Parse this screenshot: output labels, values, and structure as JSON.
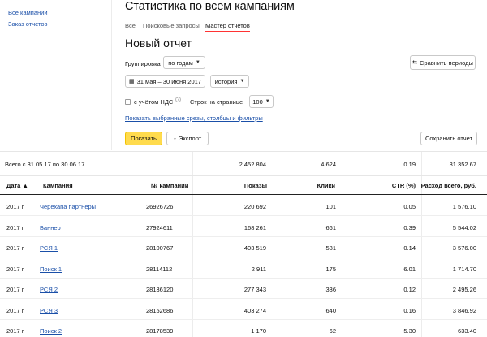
{
  "nav": {
    "all_campaigns": "Все кампании",
    "order_reports": "Заказ отчетов"
  },
  "header": {
    "title": "Статистика по всем кампаниям",
    "tabs": [
      {
        "label": "Все",
        "active": false
      },
      {
        "label": "Поисковые запросы",
        "active": false
      },
      {
        "label": "Мастер отчетов",
        "active": true
      }
    ]
  },
  "report": {
    "title": "Новый отчет",
    "grouping_label": "Группировка",
    "grouping_value": "по годам",
    "compare_periods": "Сравнить периоды",
    "date_range": "31 мая – 30 июня 2017",
    "history_value": "история",
    "vat_label": "с учётом НДС",
    "vat_help": "?",
    "rows_per_page_label": "Строк на странице",
    "rows_per_page_value": "100",
    "show_selected_link": "Показать выбранные срезы, столбцы и фильтры",
    "show_button": "Показать",
    "export_button": "Экспорт",
    "save_button": "Сохранить отчет"
  },
  "totals": {
    "label": "Всего с 31.05.17 по 30.06.17",
    "impressions": "2 452 804",
    "clicks": "4 624",
    "ctr": "0.19",
    "spend": "31 352.67"
  },
  "table": {
    "columns": [
      "Дата ▲",
      "Кампания",
      "№ кампании",
      "Показы",
      "Клики",
      "CTR (%)",
      "Расход всего, руб."
    ],
    "rows": [
      {
        "date": "2017 г",
        "campaign": "Черехапа партнёры",
        "id": "26926726",
        "impressions": "220 692",
        "clicks": "101",
        "ctr": "0.05",
        "spend": "1 576.10"
      },
      {
        "date": "2017 г",
        "campaign": "Баннер",
        "id": "27924611",
        "impressions": "168 261",
        "clicks": "661",
        "ctr": "0.39",
        "spend": "5 544.02"
      },
      {
        "date": "2017 г",
        "campaign": "РСЯ 1",
        "id": "28100767",
        "impressions": "403 519",
        "clicks": "581",
        "ctr": "0.14",
        "spend": "3 576.00"
      },
      {
        "date": "2017 г",
        "campaign": "Поиск 1",
        "id": "28114112",
        "impressions": "2 911",
        "clicks": "175",
        "ctr": "6.01",
        "spend": "1 714.70"
      },
      {
        "date": "2017 г",
        "campaign": "РСЯ 2",
        "id": "28136120",
        "impressions": "277 343",
        "clicks": "336",
        "ctr": "0.12",
        "spend": "2 495.26"
      },
      {
        "date": "2017 г",
        "campaign": "РСЯ 3",
        "id": "28152686",
        "impressions": "403 274",
        "clicks": "640",
        "ctr": "0.16",
        "spend": "3 846.92"
      },
      {
        "date": "2017 г",
        "campaign": "Поиск 2",
        "id": "28178539",
        "impressions": "1 170",
        "clicks": "62",
        "ctr": "5.30",
        "spend": "633.40"
      }
    ]
  },
  "icons": [
    "compare-icon",
    "calendar-icon",
    "export-icon",
    "chevron-down-icon",
    "help-icon"
  ]
}
